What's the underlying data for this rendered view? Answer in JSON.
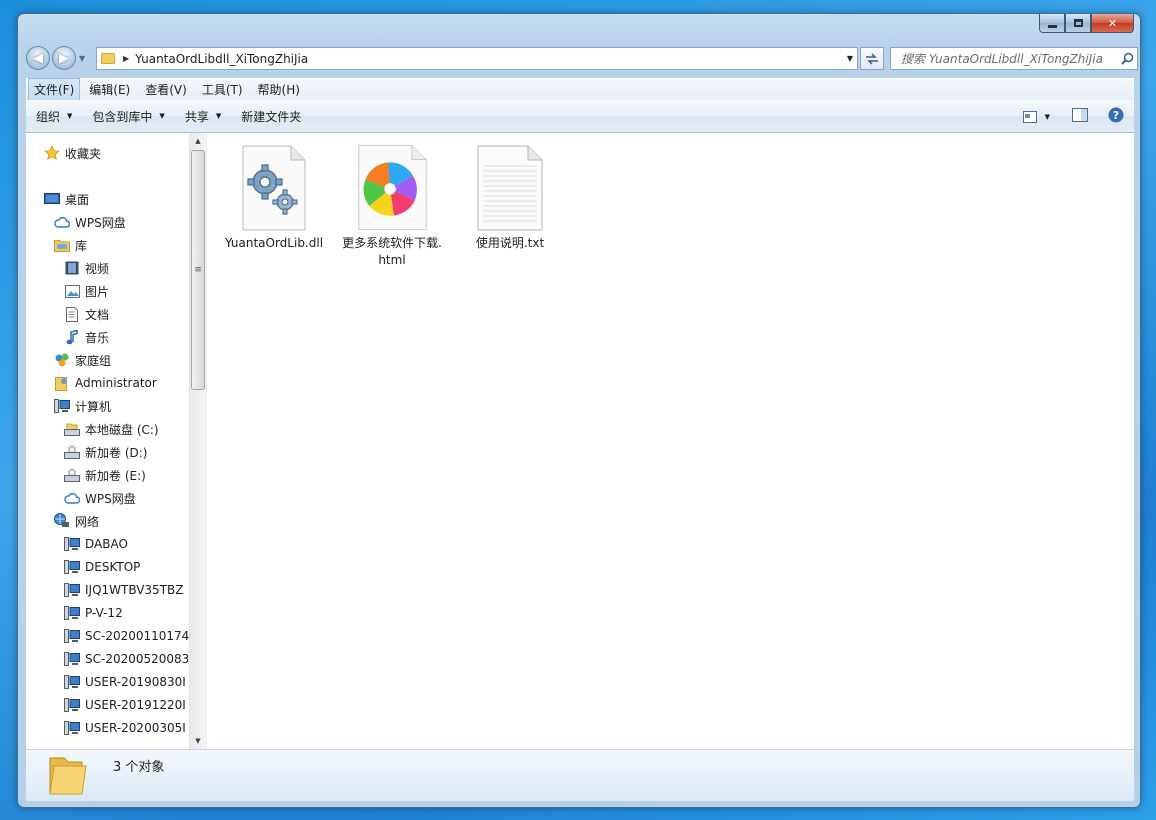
{
  "window": {
    "controls": {
      "minimize": "",
      "maximize": "",
      "close": "✕"
    }
  },
  "nav": {
    "back_glyph": "◀",
    "forward_glyph": "▶",
    "address": "YuantaOrdLibdll_XiTongZhiJia",
    "search_placeholder": "搜索 YuantaOrdLibdll_XiTongZhiJia"
  },
  "menu": [
    "文件(F)",
    "编辑(E)",
    "查看(V)",
    "工具(T)",
    "帮助(H)"
  ],
  "toolbar": {
    "organize": "组织",
    "include_library": "包含到库中",
    "share": "共享",
    "new_folder": "新建文件夹"
  },
  "navpane": {
    "favorites": "收藏夹",
    "desktop": "桌面",
    "wps_drive": "WPS网盘",
    "libraries": "库",
    "videos": "视频",
    "pictures": "图片",
    "documents": "文档",
    "music": "音乐",
    "homegroup": "家庭组",
    "administrator": "Administrator",
    "computer": "计算机",
    "drive_c": "本地磁盘 (C:)",
    "drive_d": "新加卷 (D:)",
    "drive_e": "新加卷 (E:)",
    "wps_drive_2": "WPS网盘",
    "network": "网络",
    "hosts": [
      "DABAO",
      "DESKTOP",
      "IJQ1WTBV35TBZ",
      "P-V-12",
      "SC-20200110174",
      "SC-20200520083",
      "USER-20190830I",
      "USER-20191220I",
      "USER-20200305I"
    ]
  },
  "files": [
    {
      "name": "YuantaOrdLib.dll",
      "icon": "dll-gear-icon"
    },
    {
      "name": "更多系统软件下载.html",
      "icon": "browser-html-icon"
    },
    {
      "name": "使用说明.txt",
      "icon": "text-file-icon"
    }
  ],
  "status": {
    "count_text": "3 个对象"
  },
  "colors": {
    "accent": "#1e8fe1",
    "selection": "#c3dbf3",
    "folder": "#f3cc60"
  }
}
